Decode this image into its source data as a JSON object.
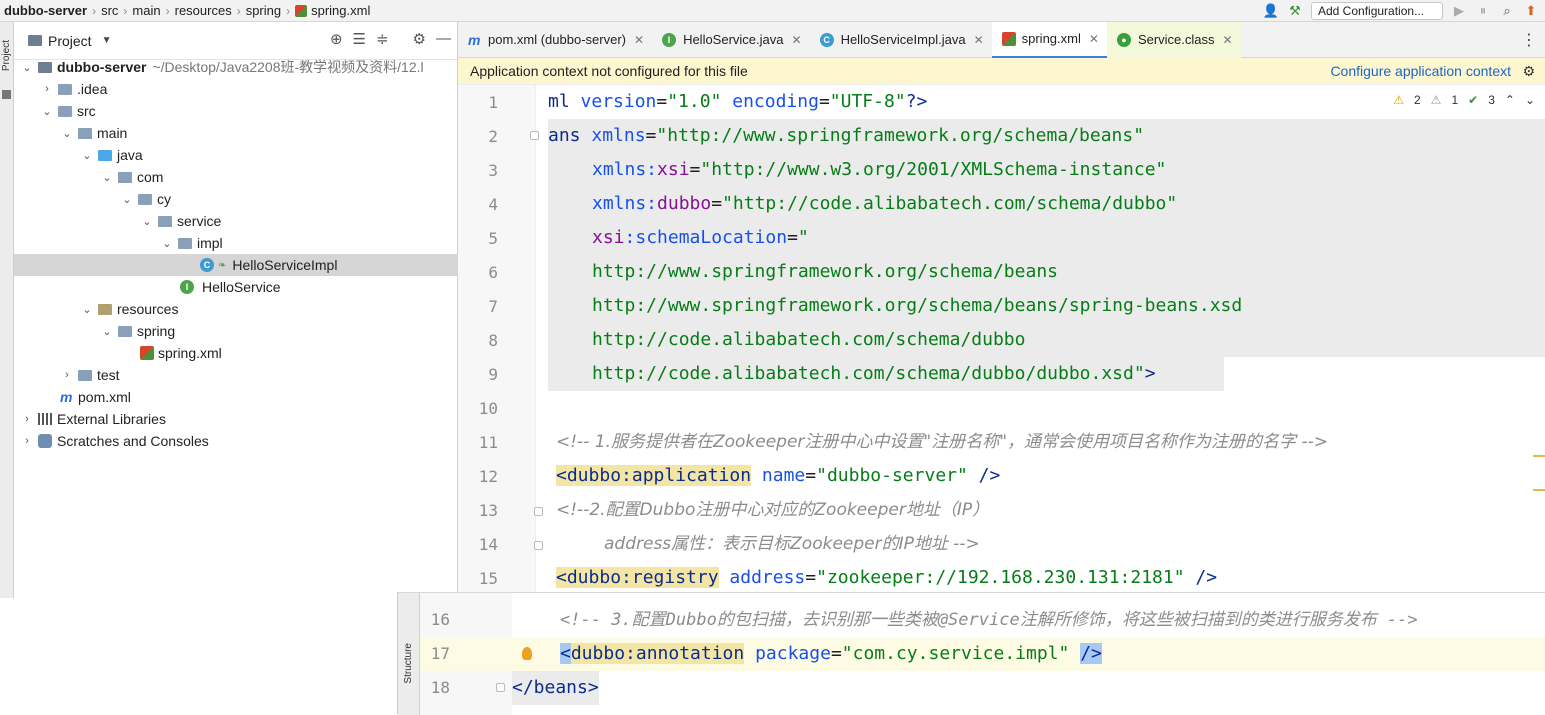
{
  "breadcrumb": {
    "project": "dubbo-server",
    "items": [
      "src",
      "main",
      "resources",
      "spring"
    ],
    "file": "spring.xml"
  },
  "toolbar": {
    "run_config": "Add Configuration..."
  },
  "side_strip": {
    "project_label": "Project",
    "structure_label": "Structure"
  },
  "project_panel": {
    "title": "Project",
    "root": {
      "name": "dubbo-server",
      "path": "~/Desktop/Java2208班-教学视频及资料/12.l"
    },
    "tree": [
      {
        "label": "idea",
        "text": ".idea"
      },
      {
        "label": "src",
        "text": "src"
      },
      {
        "label": "main",
        "text": "main"
      },
      {
        "label": "java",
        "text": "java"
      },
      {
        "label": "com",
        "text": "com"
      },
      {
        "label": "cy",
        "text": "cy"
      },
      {
        "label": "service",
        "text": "service"
      },
      {
        "label": "impl",
        "text": "impl"
      },
      {
        "label": "impl-class",
        "text": "HelloServiceImpl"
      },
      {
        "label": "interface",
        "text": "HelloService"
      },
      {
        "label": "resources",
        "text": "resources"
      },
      {
        "label": "spring",
        "text": "spring"
      },
      {
        "label": "spring-xml",
        "text": "spring.xml"
      },
      {
        "label": "test",
        "text": "test"
      },
      {
        "label": "pom",
        "text": "pom.xml"
      },
      {
        "label": "ext-libs",
        "text": "External Libraries"
      },
      {
        "label": "scratches",
        "text": "Scratches and Consoles"
      }
    ]
  },
  "tabs": [
    {
      "label": "pom.xml (dubbo-server)",
      "icon": "m"
    },
    {
      "label": "HelloService.java",
      "icon": "I"
    },
    {
      "label": "HelloServiceImpl.java",
      "icon": "C"
    },
    {
      "label": "spring.xml",
      "icon": "xml"
    },
    {
      "label": "Service.class",
      "icon": "class"
    }
  ],
  "notice": {
    "message": "Application context not configured for this file",
    "link": "Configure application context"
  },
  "inspections": {
    "warnings": "2",
    "weak": "1",
    "ok": "3"
  },
  "line_numbers": [
    "1",
    "2",
    "3",
    "4",
    "5",
    "6",
    "7",
    "8",
    "9",
    "10",
    "11",
    "12",
    "13",
    "14",
    "15"
  ],
  "code": {
    "l1": {
      "a": "ml ",
      "b": "version",
      "c": "=",
      "d": "\"1.0\"",
      "e": " encoding",
      "f": "=",
      "g": "\"UTF-8\"",
      "h": "?>"
    },
    "l2": {
      "a": "ans ",
      "b": "xmlns",
      "c": "=",
      "d": "\"http://www.springframework.org/schema/beans\""
    },
    "l3": {
      "a": "xmlns:",
      "b": "xsi",
      "c": "=",
      "d": "\"http://www.w3.org/2001/XMLSchema-instance\""
    },
    "l4": {
      "a": "xmlns:",
      "b": "dubbo",
      "c": "=",
      "d": "\"http://code.alibabatech.com/schema/dubbo\""
    },
    "l5": {
      "a": "xsi",
      "b": ":schemaLocation",
      "c": "=",
      "d": "\""
    },
    "l6": "http://www.springframework.org/schema/beans",
    "l7": "http://www.springframework.org/schema/beans/spring-beans.xsd",
    "l8": "http://code.alibabatech.com/schema/dubbo",
    "l9": {
      "a": "http://code.alibabatech.com/schema/dubbo/dubbo.xsd",
      "b": "\"",
      "c": ">"
    },
    "l11": "<!-- 1.服务提供者在Zookeeper注册中心中设置\"注册名称\"，通常会使用项目名称作为注册的名字 -->",
    "l12": {
      "a": "<",
      "b": "dubbo:application",
      "c": " name",
      "d": "=",
      "e": "\"dubbo-server\"",
      "f": " />"
    },
    "l13": "<!--2.配置Dubbo注册中心对应的Zookeeper地址（IP）",
    "l14": "address属性：表示目标Zookeeper的IP地址 -->",
    "l15": {
      "a": "<",
      "b": "dubbo:registry",
      "c": " address",
      "d": "=",
      "e": "\"zookeeper://192.168.230.131:2181\"",
      "f": " />"
    }
  },
  "overlay": {
    "line_numbers": [
      "16",
      "17",
      "18"
    ],
    "l16": "<!-- 3.配置Dubbo的包扫描，去识别那一些类被@Service注解所修饰，将这些被扫描到的类进行服务发布 -->",
    "l17": {
      "a": "<",
      "b": "dubbo:annotation",
      "c": " package",
      "d": "=",
      "e": "\"com.cy.service.impl\"",
      "f": " ",
      "g": "/>"
    },
    "l18": "</beans>"
  },
  "colors": {
    "accent": "#3b7ee0",
    "notice_bg": "#fcf7cf",
    "string": "#067d17",
    "tag": "#0b2c8f",
    "attr": "#1750eb",
    "comment": "#8c8c8c"
  }
}
